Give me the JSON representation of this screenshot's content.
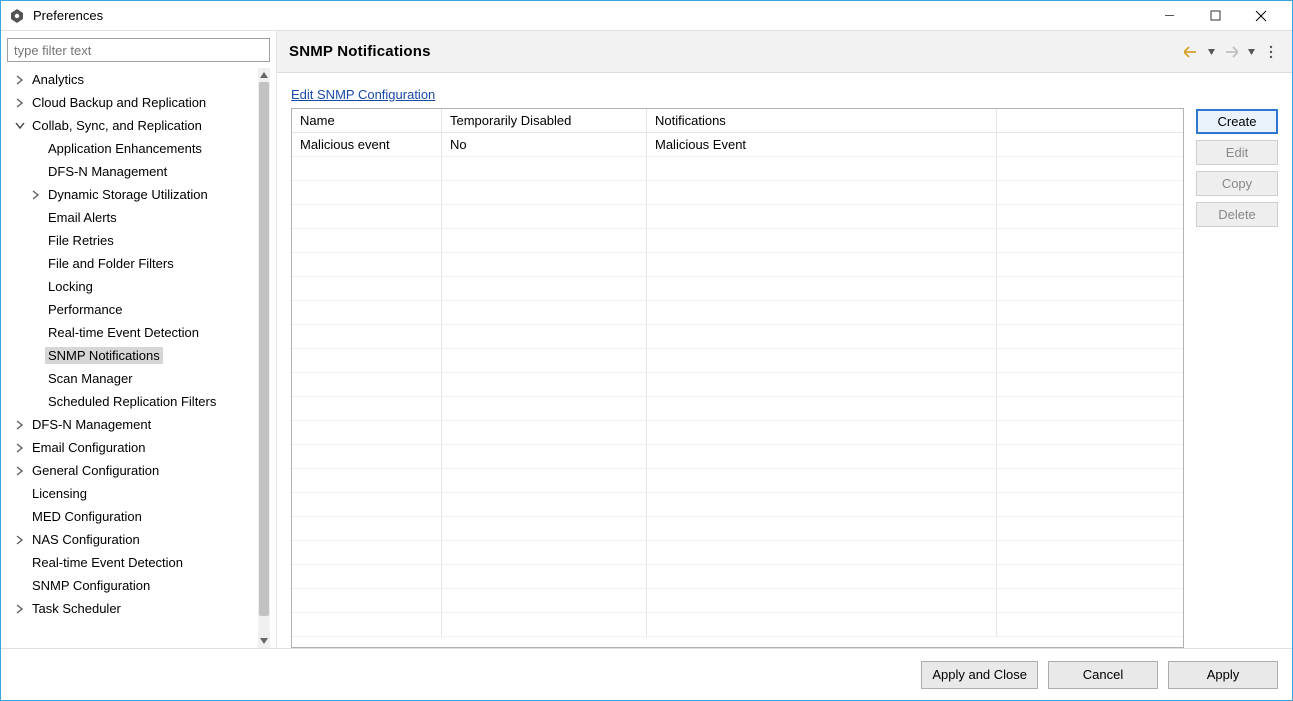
{
  "window": {
    "title": "Preferences"
  },
  "sidebar": {
    "filter_placeholder": "type filter text",
    "items": [
      {
        "label": "Analytics",
        "expandable": true,
        "expanded": false,
        "indent": 0
      },
      {
        "label": "Cloud Backup and Replication",
        "expandable": true,
        "expanded": false,
        "indent": 0
      },
      {
        "label": "Collab, Sync, and Replication",
        "expandable": true,
        "expanded": true,
        "indent": 0
      },
      {
        "label": "Application Enhancements",
        "expandable": false,
        "indent": 1
      },
      {
        "label": "DFS-N Management",
        "expandable": false,
        "indent": 1
      },
      {
        "label": "Dynamic Storage Utilization",
        "expandable": true,
        "expanded": false,
        "indent": 1
      },
      {
        "label": "Email Alerts",
        "expandable": false,
        "indent": 1
      },
      {
        "label": "File Retries",
        "expandable": false,
        "indent": 1
      },
      {
        "label": "File and Folder Filters",
        "expandable": false,
        "indent": 1
      },
      {
        "label": "Locking",
        "expandable": false,
        "indent": 1
      },
      {
        "label": "Performance",
        "expandable": false,
        "indent": 1
      },
      {
        "label": "Real-time Event Detection",
        "expandable": false,
        "indent": 1
      },
      {
        "label": "SNMP Notifications",
        "expandable": false,
        "indent": 1,
        "selected": true
      },
      {
        "label": "Scan Manager",
        "expandable": false,
        "indent": 1
      },
      {
        "label": "Scheduled Replication Filters",
        "expandable": false,
        "indent": 1
      },
      {
        "label": "DFS-N Management",
        "expandable": true,
        "expanded": false,
        "indent": 0
      },
      {
        "label": "Email Configuration",
        "expandable": true,
        "expanded": false,
        "indent": 0
      },
      {
        "label": "General Configuration",
        "expandable": true,
        "expanded": false,
        "indent": 0
      },
      {
        "label": "Licensing",
        "expandable": false,
        "indent": 0
      },
      {
        "label": "MED Configuration",
        "expandable": false,
        "indent": 0
      },
      {
        "label": "NAS Configuration",
        "expandable": true,
        "expanded": false,
        "indent": 0
      },
      {
        "label": "Real-time Event Detection",
        "expandable": false,
        "indent": 0
      },
      {
        "label": "SNMP Configuration",
        "expandable": false,
        "indent": 0
      },
      {
        "label": "Task Scheduler",
        "expandable": true,
        "expanded": false,
        "indent": 0
      }
    ]
  },
  "page": {
    "title": "SNMP Notifications",
    "config_link": "Edit SNMP Configuration",
    "table": {
      "columns": [
        "Name",
        "Temporarily Disabled",
        "Notifications",
        ""
      ],
      "rows": [
        {
          "name": "Malicious event",
          "disabled": "No",
          "notifications": "Malicious Event",
          "extra": ""
        }
      ],
      "blank_row_count": 20
    },
    "buttons": {
      "create": "Create",
      "edit": "Edit",
      "copy": "Copy",
      "delete": "Delete"
    }
  },
  "footer": {
    "apply_close": "Apply and Close",
    "cancel": "Cancel",
    "apply": "Apply"
  }
}
